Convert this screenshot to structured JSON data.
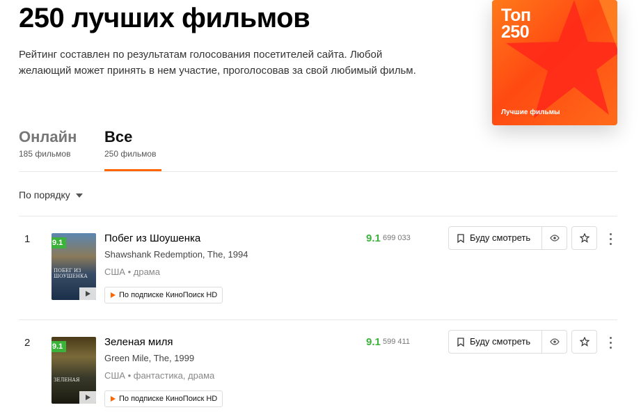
{
  "page": {
    "title": "250 лучших фильмов",
    "description": "Рейтинг составлен по результатам голосования посетителей сайта. Любой желающий может принять в нем участие, проголосовав за свой любимый фильм."
  },
  "cover": {
    "title_line1": "Топ",
    "title_line2": "250",
    "subtitle": "Лучшие фильмы"
  },
  "tabs": [
    {
      "label": "Онлайн",
      "count": "185 фильмов",
      "active": false
    },
    {
      "label": "Все",
      "count": "250 фильмов",
      "active": true
    }
  ],
  "sort": {
    "label": "По порядку"
  },
  "films": [
    {
      "rank": "1",
      "badge": "9.1",
      "poster_text": "ПОБЕГ ИЗ ШОУШЕНКА",
      "title": "Побег из Шоушенка",
      "original": "Shawshank Redemption, The, 1994",
      "meta": "США • драма",
      "subscription": "По подписке КиноПоиск HD",
      "rating": "9.1",
      "votes": "699 033",
      "watch_label": "Буду смотреть"
    },
    {
      "rank": "2",
      "badge": "9.1",
      "poster_text": "ЗЕЛЕНАЯ",
      "title": "Зеленая миля",
      "original": "Green Mile, The, 1999",
      "meta": "США • фантастика, драма",
      "subscription": "По подписке КиноПоиск HD",
      "rating": "9.1",
      "votes": "599 411",
      "watch_label": "Буду смотреть"
    }
  ],
  "colors": {
    "accent": "#ff6600",
    "rating_green": "#3bb33b"
  }
}
